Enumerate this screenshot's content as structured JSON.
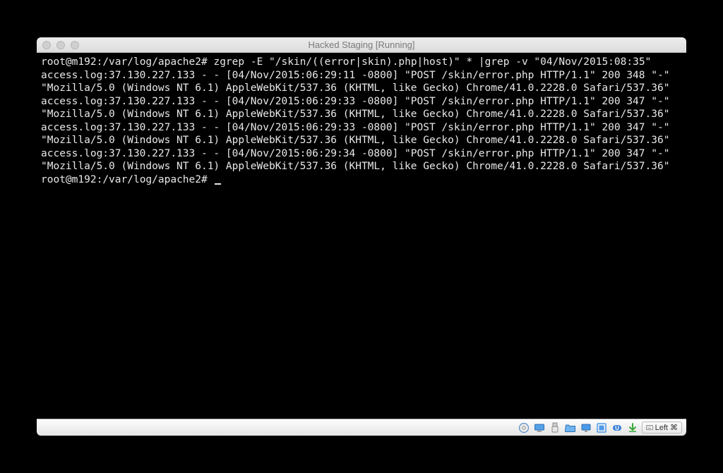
{
  "window": {
    "title": "Hacked Staging [Running]"
  },
  "terminal": {
    "prompt1_user_host": "root@m192",
    "prompt1_path": "/var/log/apache2",
    "prompt1_symbol": "#",
    "command": "zgrep -E \"/skin/((error|skin).php|host)\" * |grep -v \"04/Nov/2015:08:35\"",
    "log_entries": [
      "access.log:37.130.227.133 - - [04/Nov/2015:06:29:11 -0800] \"POST /skin/error.php HTTP/1.1\" 200 348 \"-\" \"Mozilla/5.0 (Windows NT 6.1) AppleWebKit/537.36 (KHTML, like Gecko) Chrome/41.0.2228.0 Safari/537.36\"",
      "access.log:37.130.227.133 - - [04/Nov/2015:06:29:33 -0800] \"POST /skin/error.php HTTP/1.1\" 200 347 \"-\" \"Mozilla/5.0 (Windows NT 6.1) AppleWebKit/537.36 (KHTML, like Gecko) Chrome/41.0.2228.0 Safari/537.36\"",
      "access.log:37.130.227.133 - - [04/Nov/2015:06:29:33 -0800] \"POST /skin/error.php HTTP/1.1\" 200 347 \"-\" \"Mozilla/5.0 (Windows NT 6.1) AppleWebKit/537.36 (KHTML, like Gecko) Chrome/41.0.2228.0 Safari/537.36\"",
      "access.log:37.130.227.133 - - [04/Nov/2015:06:29:34 -0800] \"POST /skin/error.php HTTP/1.1\" 200 347 \"-\" \"Mozilla/5.0 (Windows NT 6.1) AppleWebKit/537.36 (KHTML, like Gecko) Chrome/41.0.2228.0 Safari/537.36\""
    ],
    "prompt2_user_host": "root@m192",
    "prompt2_path": "/var/log/apache2",
    "prompt2_symbol": "#"
  },
  "statusbar": {
    "host_key_label": "Left ⌘",
    "arrow_glyph": "⬇",
    "cd_glyph": "◎",
    "monitors_glyph": "🖥",
    "usb_glyph": "🔌",
    "folder_glyph": "📁",
    "display_glyph": "🖵",
    "window_glyph": "▭",
    "pill_glyph": "Ⓤ"
  }
}
